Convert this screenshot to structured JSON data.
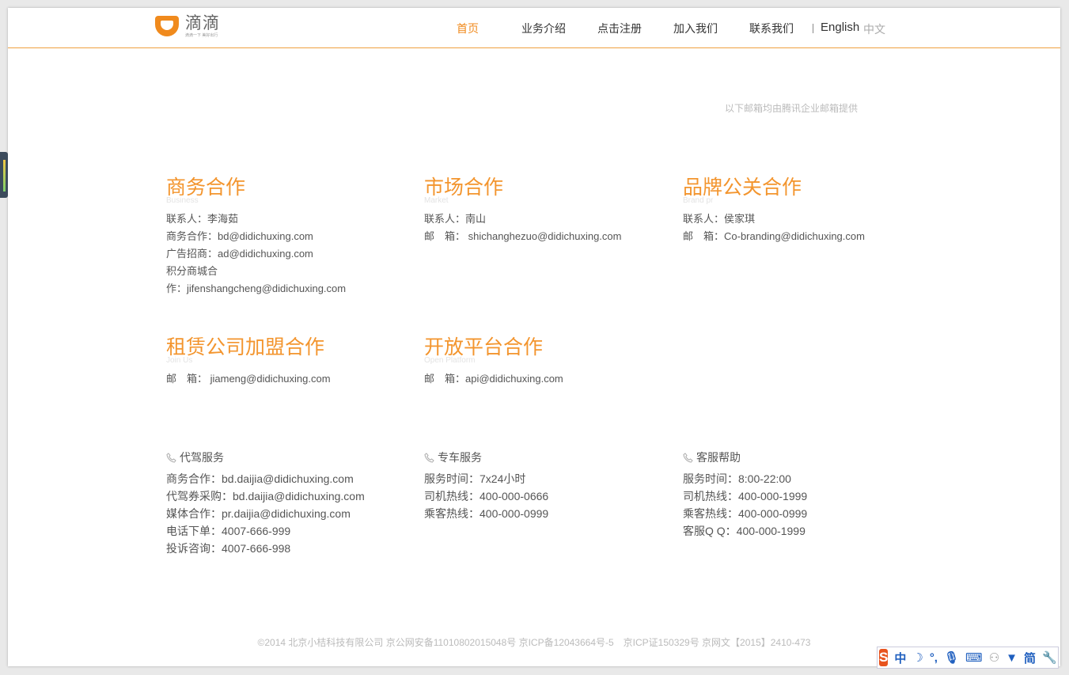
{
  "brand": {
    "name": "滴滴",
    "slogan": "滴滴一下 美好出行"
  },
  "nav": [
    {
      "label": "首页",
      "active": true
    },
    {
      "label": "业务介绍",
      "active": false
    },
    {
      "label": "点击注册",
      "active": false
    },
    {
      "label": "加入我们",
      "active": false
    },
    {
      "label": "联系我们",
      "active": false
    }
  ],
  "lang": {
    "en": "English",
    "cn": "中文"
  },
  "notice": "以下邮箱均由腾讯企业邮箱提供",
  "cooperation": {
    "business": {
      "title": "商务合作",
      "subtitle": "Business",
      "lines": [
        "联系人：李海茹",
        "商务合作：bd@didichuxing.com",
        "广告招商：ad@didichuxing.com",
        "积分商城合",
        "作：jifenshangcheng@didichuxing.com"
      ]
    },
    "market": {
      "title": "市场合作",
      "subtitle": "Market",
      "lines": [
        "联系人：南山",
        "邮　箱： shichanghezuo@didichuxing.com"
      ]
    },
    "brand_pr": {
      "title": "品牌公关合作",
      "subtitle": "Brand pr",
      "lines": [
        "联系人：侯家琪",
        "邮　箱：Co-branding@didichuxing.com"
      ]
    },
    "join": {
      "title": "租赁公司加盟合作",
      "subtitle": "Join Us",
      "lines": [
        "邮　箱： jiameng@didichuxing.com"
      ]
    },
    "platform": {
      "title": "开放平台合作",
      "subtitle": "Open Platform",
      "lines": [
        "邮　箱：api@didichuxing.com"
      ]
    }
  },
  "services": {
    "daijia": {
      "title": "代驾服务",
      "lines": [
        "商务合作：bd.daijia@didichuxing.com",
        "代驾券采购：bd.daijia@didichuxing.com",
        "媒体合作：pr.daijia@didichuxing.com",
        "电话下单：4007-666-999",
        "投诉咨询：4007-666-998"
      ]
    },
    "zhuanche": {
      "title": "专车服务",
      "lines": [
        "服务时间：7x24小时",
        "司机热线：400-000-0666",
        "乘客热线：400-000-0999"
      ]
    },
    "kefu": {
      "title": "客服帮助",
      "lines": [
        "服务时间：8:00-22:00",
        "司机热线：400-000-1999",
        "乘客热线：400-000-0999",
        "客服Q Q：400-000-1999"
      ]
    }
  },
  "footer": "©2014 北京小桔科技有限公司 京公网安备11010802015048号 京ICP备12043664号-5　京ICP证150329号 京网文【2015】2410-473",
  "ime": {
    "logo": "S",
    "mode": "中",
    "simplified": "简"
  },
  "colors": {
    "accent": "#f08a1d",
    "heading": "#f3952e"
  }
}
